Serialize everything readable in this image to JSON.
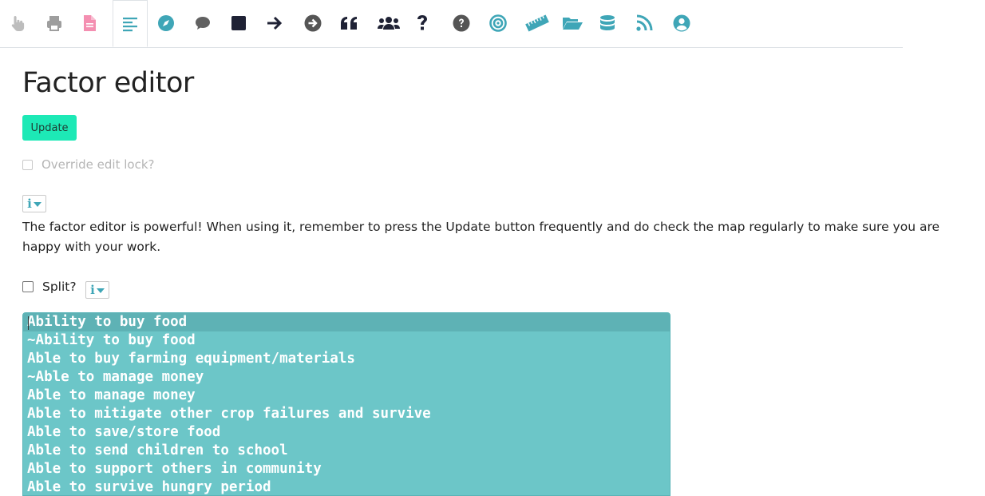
{
  "toolbar": {
    "icons": [
      {
        "name": "hand-pointer-icon",
        "color": "#bdbdbd"
      },
      {
        "name": "print-icon",
        "color": "#9e9e9e"
      },
      {
        "name": "file-icon",
        "color": "#f48fb1"
      },
      {
        "name": "align-left-icon",
        "color": "#3fa6b7",
        "active": true
      },
      {
        "name": "compass-icon",
        "color": "#3fa6b7"
      },
      {
        "name": "comment-icon",
        "color": "#616161"
      },
      {
        "name": "square-icon",
        "color": "#1f2235"
      },
      {
        "name": "arrow-right-icon",
        "color": "#1f2235"
      },
      {
        "name": "arrow-circle-right-icon",
        "color": "#555"
      },
      {
        "name": "quote-left-icon",
        "color": "#1f2235"
      },
      {
        "name": "users-icon",
        "color": "#1f2235"
      },
      {
        "name": "question-icon",
        "color": "#1f2235"
      },
      {
        "name": "question-circle-icon",
        "color": "#555"
      },
      {
        "name": "bullseye-icon",
        "color": "#3fa6b7"
      },
      {
        "name": "ruler-icon",
        "color": "#3fa6b7"
      },
      {
        "name": "folder-open-icon",
        "color": "#3fa6b7"
      },
      {
        "name": "database-icon",
        "color": "#3fa6b7"
      },
      {
        "name": "rss-icon",
        "color": "#3fa6b7"
      },
      {
        "name": "user-circle-icon",
        "color": "#3fa6b7"
      }
    ]
  },
  "page": {
    "title": "Factor editor",
    "update_label": "Update",
    "override_label": "Override edit lock?",
    "help_text": "The factor editor is powerful! When using it, remember to press the Update button frequently and do check the map regularly to make sure you are happy with your work.",
    "split_label": "Split?"
  },
  "editor": {
    "lines": [
      "Ability to buy food",
      "~Ability to buy food",
      "Able to buy farming equipment/materials",
      "~Able to manage money",
      "Able to manage money",
      "Able to mitigate other crop failures and survive",
      "Able to save/store food",
      "Able to send children to school",
      "Able to support others in community",
      "Able to survive hungry period"
    ]
  },
  "colors": {
    "accent": "#1de9b6",
    "teal": "#3fa6b7",
    "editor_bg": "#6cc6c8"
  }
}
